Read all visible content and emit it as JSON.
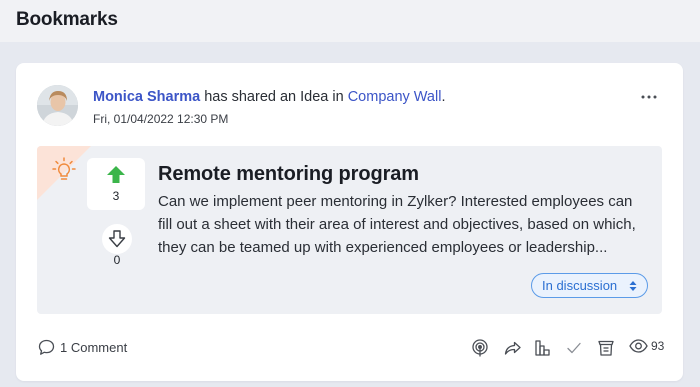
{
  "header": {
    "title": "Bookmarks"
  },
  "post": {
    "author": "Monica Sharma",
    "action_text": " has shared an Idea in ",
    "location": "Company Wall",
    "period": ".",
    "timestamp": "Fri, 01/04/2022 12:30 PM",
    "more_icon": "more-horizontal-icon"
  },
  "idea": {
    "icon": "lightbulb-icon",
    "title": "Remote mentoring program",
    "description": "Can we implement peer mentoring in Zylker? Interested employees can fill out a sheet with their area of interest and objectives, based on which, they can be teamed up with experienced employees or leadership...",
    "upvotes": "3",
    "downvotes": "0",
    "status": "In discussion"
  },
  "footer": {
    "comments": "1 Comment",
    "views": "93",
    "actions": [
      "podcast-icon",
      "share-icon",
      "poll-chart-icon",
      "check-icon",
      "archive-icon"
    ]
  },
  "colors": {
    "link": "#3c55c7",
    "upvote": "#3bb54a",
    "idea_corner": "#fce3d8",
    "idea_icon": "#f08a3c",
    "status_border": "#5b9be8",
    "status_text": "#2b6fd1"
  }
}
